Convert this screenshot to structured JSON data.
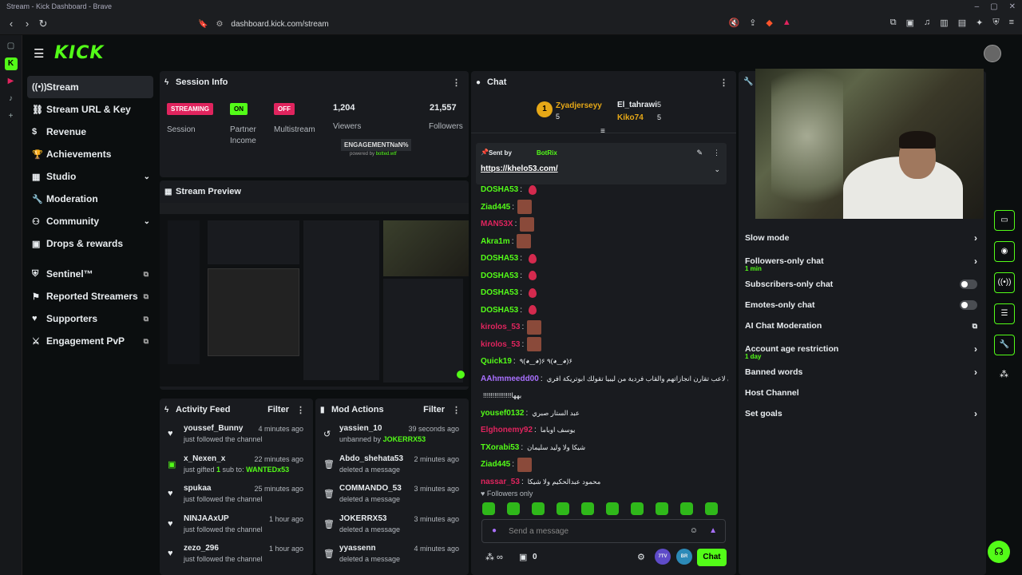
{
  "window": {
    "title": "Stream - Kick Dashboard - Brave"
  },
  "browser": {
    "url": "dashboard.kick.com/stream"
  },
  "app": {
    "logo": "KICK"
  },
  "nav": {
    "items": [
      {
        "label": "Stream",
        "icon": "radio-icon"
      },
      {
        "label": "Stream URL & Key",
        "icon": "link-icon"
      },
      {
        "label": "Revenue",
        "icon": "dollar-icon"
      },
      {
        "label": "Achievements",
        "icon": "trophy-icon"
      },
      {
        "label": "Studio",
        "icon": "studio-icon"
      },
      {
        "label": "Moderation",
        "icon": "wrench-icon"
      },
      {
        "label": "Community",
        "icon": "people-icon"
      },
      {
        "label": "Drops & rewards",
        "icon": "gift-icon"
      },
      {
        "label": "Sentinel™",
        "icon": "shield-icon"
      },
      {
        "label": "Reported Streamers",
        "icon": "flag-icon"
      },
      {
        "label": "Supporters",
        "icon": "heart-icon"
      },
      {
        "label": "Engagement PvP",
        "icon": "swords-icon"
      }
    ]
  },
  "session": {
    "title": "Session Info",
    "streaming_badge": "STREAMING",
    "session_label": "Session",
    "partner_badge": "ON",
    "partner_label_1": "Partner",
    "partner_label_2": "Income",
    "multistream_badge": "OFF",
    "multistream_label": "Multistream",
    "viewers": "1,204",
    "viewers_label": "Viewers",
    "followers": "21,557",
    "followers_label": "Followers",
    "engagement": "ENGAGEMENTNaN%",
    "powered": "powered by",
    "powered_brand": "botted.wtf"
  },
  "preview": {
    "title": "Stream Preview"
  },
  "activity": {
    "title": "Activity Feed",
    "filter": "Filter",
    "items": [
      {
        "name": "youssef_Bunny",
        "time": "4 minutes ago",
        "desc": "just followed the channel"
      },
      {
        "name": "x_Nexen_x",
        "time": "22 minutes ago",
        "desc_pre": "just gifted ",
        "desc_num": "1",
        "desc_mid": " sub to: ",
        "desc_hl": "WANTEDx53"
      },
      {
        "name": "spukaa",
        "time": "25 minutes ago",
        "desc": "just followed the channel"
      },
      {
        "name": "NINJAAxUP",
        "time": "1 hour ago",
        "desc": "just followed the channel"
      },
      {
        "name": "zezo_296",
        "time": "1 hour ago",
        "desc": "just followed the channel"
      }
    ]
  },
  "mod": {
    "title": "Mod Actions",
    "filter": "Filter",
    "items": [
      {
        "name": "yassien_10",
        "time": "39 seconds ago",
        "desc_pre": "unbanned by ",
        "desc_hl": "JOKERRX53"
      },
      {
        "name": "Abdo_shehata53",
        "time": "2 minutes ago",
        "desc": "deleted a message"
      },
      {
        "name": "COMMANDO_53",
        "time": "3 minutes ago",
        "desc": "deleted a message"
      },
      {
        "name": "JOKERRX53",
        "time": "3 minutes ago",
        "desc": "deleted a message"
      },
      {
        "name": "yyassenn",
        "time": "4 minutes ago",
        "desc": "deleted a message"
      }
    ]
  },
  "chat": {
    "title": "Chat",
    "top1": {
      "rank": "1",
      "name": "Zyadjerseyy",
      "count": "5"
    },
    "top2": {
      "name": "El_tahrawi",
      "count": "5"
    },
    "top3": {
      "name": "Kiko74",
      "count": "5"
    },
    "pinned": {
      "sent_by": "Sent by",
      "user": "BotRix",
      "link": "https://khelo53.com/"
    },
    "messages": [
      {
        "user": "DOSHA53",
        "color": "#53fc18",
        "emote": "drop"
      },
      {
        "user": "Ziad445",
        "color": "#53fc18",
        "emote": "img"
      },
      {
        "user": "MAN53X",
        "color": "#e0245e",
        "emote": "img"
      },
      {
        "user": "Akra1m",
        "color": "#53fc18",
        "emote": "img"
      },
      {
        "user": "DOSHA53",
        "color": "#53fc18",
        "emote": "drop"
      },
      {
        "user": "DOSHA53",
        "color": "#53fc18",
        "emote": "drop"
      },
      {
        "user": "DOSHA53",
        "color": "#53fc18",
        "emote": "drop"
      },
      {
        "user": "DOSHA53",
        "color": "#53fc18",
        "emote": "drop"
      },
      {
        "user": "kirolos_53",
        "color": "#e0245e",
        "emote": "img"
      },
      {
        "user": "kirolos_53",
        "color": "#e0245e",
        "emote": "img"
      },
      {
        "user": "Quick19",
        "color": "#53fc18",
        "text": "٩(◕‿◕)۶ ٩(◕‿◕)۶"
      },
      {
        "user": "AAhmmeedd00",
        "color": "#a970ff",
        "text": "لما بتقارن لاعب تقارن انجازاتهم والقاب فردية من ليبيا تقولك ابوتريكة افري"
      },
      {
        "user": "",
        "color": "#fff",
        "text": "!!!!!!!!!!!!!!!بهها"
      },
      {
        "user": "yousef0132",
        "color": "#53fc18",
        "text": "عبد الستار صبري"
      },
      {
        "user": "Elghonemy92",
        "color": "#e0245e",
        "text": "يوسف اوباما"
      },
      {
        "user": "TXorabi53",
        "color": "#53fc18",
        "text": "شيكا ولا وليد سليمان"
      },
      {
        "user": "Ziad445",
        "color": "#53fc18",
        "emote": "img"
      },
      {
        "user": "nassar_53",
        "color": "#e0245e",
        "text": "محمود عبدالحكيم ولا شيكا"
      }
    ],
    "followers_only": "Followers only",
    "placeholder": "Send a message",
    "count": "0",
    "send": "Chat",
    "b1": "7TV",
    "b2": "BR"
  },
  "settings": {
    "items": [
      {
        "label": "Slow mode",
        "type": "arrow"
      },
      {
        "label": "Followers-only chat",
        "sub": "1 min",
        "type": "arrow"
      },
      {
        "label": "Subscribers-only chat",
        "type": "toggle"
      },
      {
        "label": "Emotes-only chat",
        "type": "toggle"
      },
      {
        "label": "AI Chat Moderation",
        "type": "ext"
      },
      {
        "label": "Account age restriction",
        "sub": "1 day",
        "type": "arrow"
      },
      {
        "label": "Banned words",
        "type": "arrow"
      },
      {
        "label": "Host Channel",
        "type": "none"
      },
      {
        "label": "Set goals",
        "type": "arrow"
      }
    ]
  },
  "colors": {
    "brand": "#53fc18",
    "danger": "#e0245e",
    "panel": "#191b1f"
  }
}
